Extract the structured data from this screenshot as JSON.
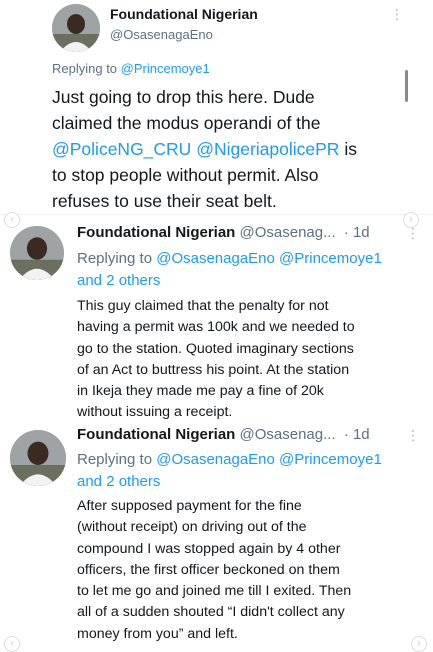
{
  "main_tweet": {
    "author_name": "Foundational Nigerian",
    "handle": "@OsasenagaEno",
    "more_icon": "more-vertical-icon",
    "replying_label": "Replying to",
    "replying_handle": "@Princemoye1",
    "body_lines": [
      {
        "pre": "Just going to drop this here. Dude",
        "m1": "",
        "mid": "",
        "m2": "",
        "post": ""
      },
      {
        "pre": "claimed the modus operandi of the",
        "m1": "",
        "mid": "",
        "m2": "",
        "post": ""
      },
      {
        "pre": "",
        "m1": "@PoliceNG_CRU",
        "mid": " ",
        "m2": "@NigeriapolicePR",
        "post": " is"
      },
      {
        "pre": "to stop people without permit. Also",
        "m1": "",
        "mid": "",
        "m2": "",
        "post": ""
      },
      {
        "pre": "refuses to use their seat belt.",
        "m1": "",
        "mid": "",
        "m2": "",
        "post": ""
      }
    ]
  },
  "replies": [
    {
      "author_name": "Foundational Nigerian",
      "handle": "@Osasenag...",
      "dot": "·",
      "time": "1d",
      "replying_label": "Replying to",
      "mention1": "@OsasenagaEno",
      "mention2": "@Princemoye1",
      "others": "and 2 others",
      "body_lines": [
        "This guy claimed that the penalty for not",
        "having a permit was 100k and we needed to",
        "go to the station. Quoted imaginary sections",
        "of an Act to buttress his point. At the station",
        "in Ikeja they made me pay a fine of 20k",
        "without issuing a receipt."
      ]
    },
    {
      "author_name": "Foundational Nigerian",
      "handle": "@Osasenag...",
      "dot": "·",
      "time": "1d",
      "replying_label": "Replying to",
      "mention1": "@OsasenagaEno",
      "mention2": "@Princemoye1",
      "others": "and 2 others",
      "body_lines": [
        "After supposed payment for the fine",
        "(without receipt) on driving out of the",
        "compound I was stopped again by 4 other",
        "officers, the first officer beckoned on them",
        "to let me go and joined me till I exited. Then",
        "all of a sudden shouted “I didn't collect any",
        "money from you” and left."
      ]
    }
  ],
  "carousel": {
    "prev_icon": "chevron-left-icon",
    "next_icon": "chevron-right-icon",
    "prev_glyph": "‹",
    "next_glyph": "›",
    "more_glyph": "⋮"
  }
}
